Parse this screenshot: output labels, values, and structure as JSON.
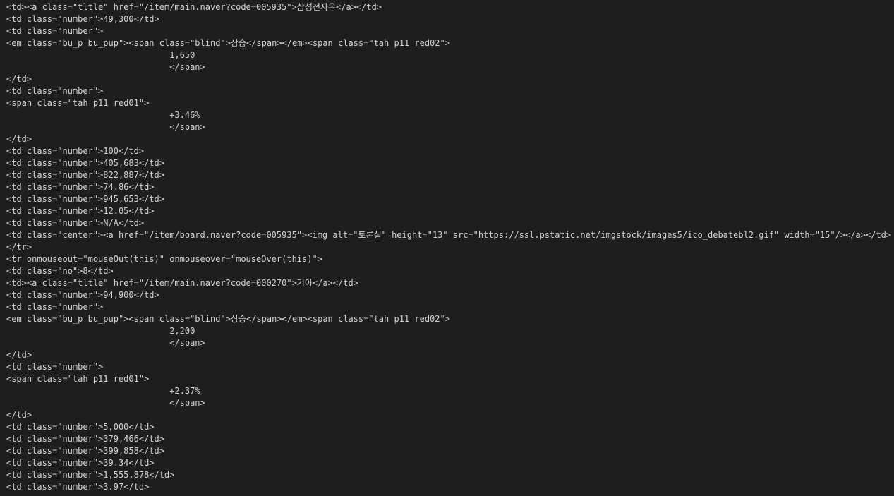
{
  "terminal": {
    "lines": [
      "<td><a class=\"tltle\" href=\"/item/main.naver?code=005935\">삼성전자우</a></td>",
      "<td class=\"number\">49,300</td>",
      "<td class=\"number\">",
      "<em class=\"bu_p bu_pup\"><span class=\"blind\">상승</span></em><span class=\"tah p11 red02\">",
      "                                1,650",
      "                                </span>",
      "</td>",
      "<td class=\"number\">",
      "<span class=\"tah p11 red01\">",
      "                                +3.46%",
      "                                </span>",
      "</td>",
      "<td class=\"number\">100</td>",
      "<td class=\"number\">405,683</td>",
      "<td class=\"number\">822,887</td>",
      "<td class=\"number\">74.86</td>",
      "<td class=\"number\">945,653</td>",
      "<td class=\"number\">12.05</td>",
      "<td class=\"number\">N/A</td>",
      "<td class=\"center\"><a href=\"/item/board.naver?code=005935\"><img alt=\"토론실\" height=\"13\" src=\"https://ssl.pstatic.net/imgstock/images5/ico_debatebl2.gif\" width=\"15\"/></a></td>",
      "</tr>",
      "<tr onmouseout=\"mouseOut(this)\" onmouseover=\"mouseOver(this)\">",
      "<td class=\"no\">8</td>",
      "<td><a class=\"tltle\" href=\"/item/main.naver?code=000270\">기아</a></td>",
      "<td class=\"number\">94,900</td>",
      "<td class=\"number\">",
      "<em class=\"bu_p bu_pup\"><span class=\"blind\">상승</span></em><span class=\"tah p11 red02\">",
      "                                2,200",
      "                                </span>",
      "</td>",
      "<td class=\"number\">",
      "<span class=\"tah p11 red01\">",
      "                                +2.37%",
      "                                </span>",
      "</td>",
      "<td class=\"number\">5,000</td>",
      "<td class=\"number\">379,466</td>",
      "<td class=\"number\">399,858</td>",
      "<td class=\"number\">39.34</td>",
      "<td class=\"number\">1,555,878</td>",
      "<td class=\"number\">3.97</td>"
    ]
  }
}
